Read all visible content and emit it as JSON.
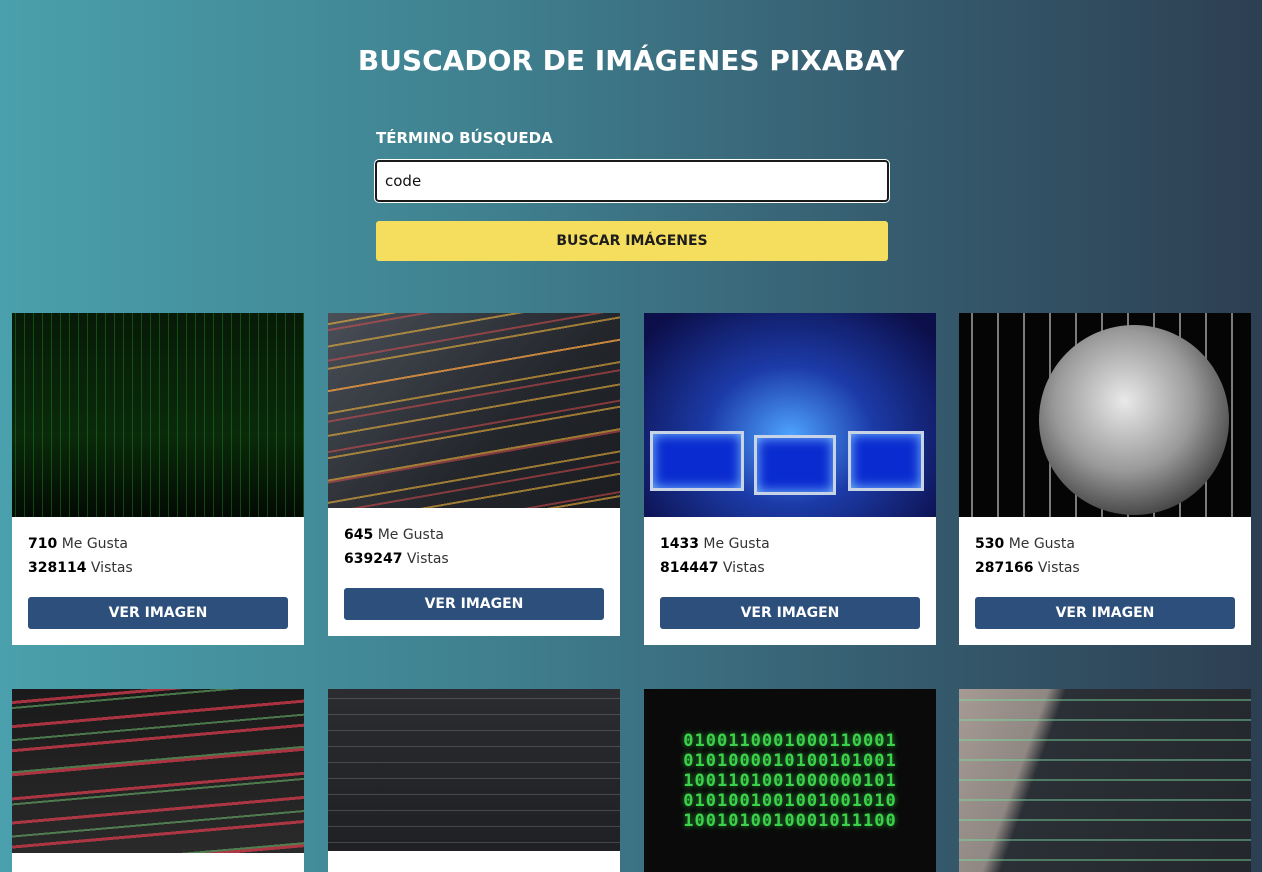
{
  "header": {
    "title": "BUSCADOR DE IMÁGENES PIXABAY"
  },
  "search": {
    "label": "TÉRMINO BÚSQUEDA",
    "value": "code",
    "button_label": "BUSCAR IMÁGENES"
  },
  "cards": [
    {
      "likes": "710",
      "likes_label": "Me Gusta",
      "views": "328114",
      "views_label": "Vistas",
      "button_label": "VER IMAGEN"
    },
    {
      "likes": "645",
      "likes_label": "Me Gusta",
      "views": "639247",
      "views_label": "Vistas",
      "button_label": "VER IMAGEN"
    },
    {
      "likes": "1433",
      "likes_label": "Me Gusta",
      "views": "814447",
      "views_label": "Vistas",
      "button_label": "VER IMAGEN"
    },
    {
      "likes": "530",
      "likes_label": "Me Gusta",
      "views": "287166",
      "views_label": "Vistas",
      "button_label": "VER IMAGEN"
    }
  ],
  "binary_rows": [
    "0100110001000110001",
    "0101000010100101001",
    "1001101001000000101",
    "0101001001001001010",
    "1001010010001011100"
  ],
  "colors": {
    "accent_button": "#f5de5e",
    "card_button": "#2c4f7c"
  }
}
